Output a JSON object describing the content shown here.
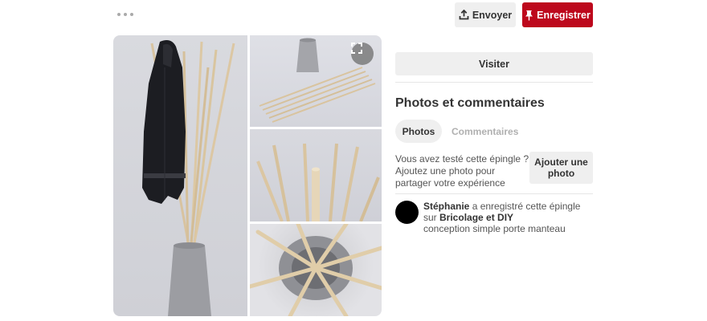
{
  "header": {
    "send_label": "Envoyer",
    "save_label": "Enregistrer",
    "colors": {
      "save_bg": "#bd081c",
      "button_bg": "#efefef"
    }
  },
  "gallery": {
    "images": [
      "coat-rack-photo",
      "rack-parts-photo",
      "wooden-sticks-photo",
      "rack-top-view-photo"
    ]
  },
  "actions": {
    "visit_label": "Visiter"
  },
  "photos_section": {
    "title": "Photos et commentaires",
    "tabs": [
      {
        "label": "Photos",
        "active": true
      },
      {
        "label": "Commentaires",
        "active": false
      }
    ],
    "tried_prompt": "Vous avez testé cette épingle ? Ajoutez une photo pour partager votre expérience",
    "add_photo_label": "Ajouter une photo"
  },
  "activity": {
    "user": "Stéphanie",
    "action_text": " a enregistré cette épingle sur ",
    "board": "Bricolage et DIY",
    "description": "conception simple porte manteau"
  },
  "icons": {
    "more": "more-dots-icon",
    "send": "upload-icon",
    "save": "pushpin-icon",
    "zoom": "expand-icon"
  }
}
